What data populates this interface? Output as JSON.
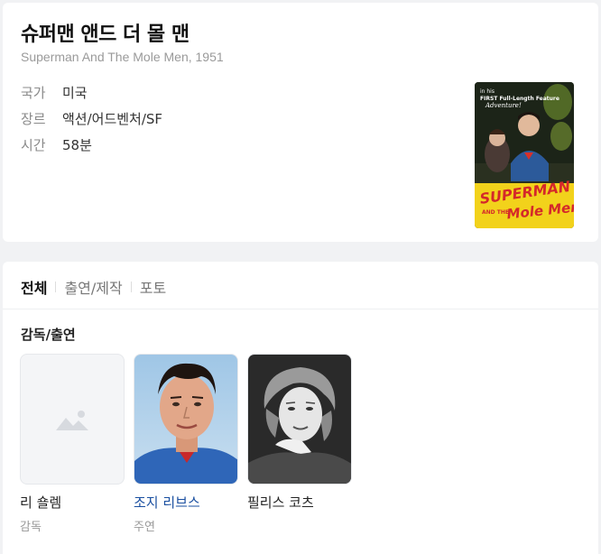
{
  "movie": {
    "title": "슈퍼맨 앤드 더 몰 맨",
    "subtitle": "Superman And The Mole Men, 1951",
    "info": [
      {
        "label": "국가",
        "value": "미국"
      },
      {
        "label": "장르",
        "value": "액션/어드벤처/SF"
      },
      {
        "label": "시간",
        "value": "58분"
      }
    ],
    "poster": {
      "top_text_1": "in his",
      "top_text_2": "FIRST Full-Length Feature",
      "top_text_3": "Adventure!",
      "logo_1": "SUPERMAN",
      "logo_2": "AND THE",
      "logo_3": "Mole Men"
    }
  },
  "tabs": [
    {
      "label": "전체",
      "active": true
    },
    {
      "label": "출연/제작",
      "active": false
    },
    {
      "label": "포토",
      "active": false
    }
  ],
  "cast_section": {
    "title": "감독/출연",
    "people": [
      {
        "name": "리 숄렘",
        "role": "감독",
        "has_photo": false,
        "linked": false
      },
      {
        "name": "조지 리브스",
        "role": "주연",
        "has_photo": true,
        "linked": true
      },
      {
        "name": "필리스 코츠",
        "role": "",
        "has_photo": true,
        "linked": false
      }
    ]
  },
  "colors": {
    "link": "#1a4fa0",
    "poster_yellow": "#f2d21b",
    "poster_red": "#d4282a"
  }
}
